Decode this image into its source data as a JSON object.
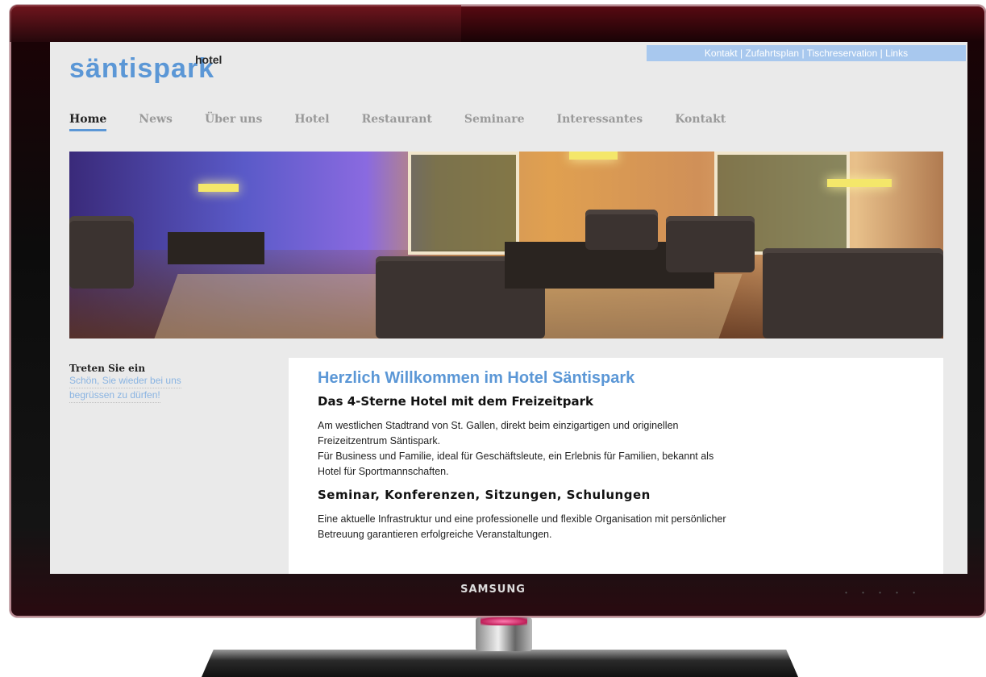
{
  "site": {
    "logo_main": "säntispark",
    "logo_small": "hotel",
    "top_links": [
      "Kontakt",
      "Zufahrtsplan",
      "Tischreservation",
      "Links"
    ],
    "top_links_separator": " | "
  },
  "nav": {
    "items": [
      "Home",
      "News",
      "Über uns",
      "Hotel",
      "Restaurant",
      "Seminare",
      "Interessantes",
      "Kontakt"
    ],
    "active": "Home"
  },
  "sidebar": {
    "title": "Treten Sie ein",
    "line1": "Schön, Sie wieder bei uns",
    "line2": "begrüssen zu dürfen!"
  },
  "content": {
    "heading": "Herzlich Willkommen im Hotel Säntispark",
    "subheading1": "Das 4-Sterne Hotel mit dem Freizeitpark",
    "para1_line1": "Am westlichen Stadtrand von St. Gallen, direkt beim einzigartigen und originellen",
    "para1_line2": "Freizeitzentrum Säntispark.",
    "para1_line3": "Für Business und Familie, ideal für Geschäftsleute, ein Erlebnis für Familien, bekannt als",
    "para1_line4": "Hotel für Sportmannschaften.",
    "subheading2": "Seminar, Konferenzen, Sitzungen, Schulungen",
    "para2_line1": "Eine aktuelle Infrastruktur und eine professionelle und flexible Organisation mit persönlicher",
    "para2_line2": "Betreuung garantieren erfolgreiche Veranstaltungen."
  },
  "tv": {
    "brand": "SAMSUNG"
  },
  "colors": {
    "accent": "#5b97d6",
    "toplinks_bg": "#a8c8ee",
    "page_bg": "#eaeaea"
  }
}
